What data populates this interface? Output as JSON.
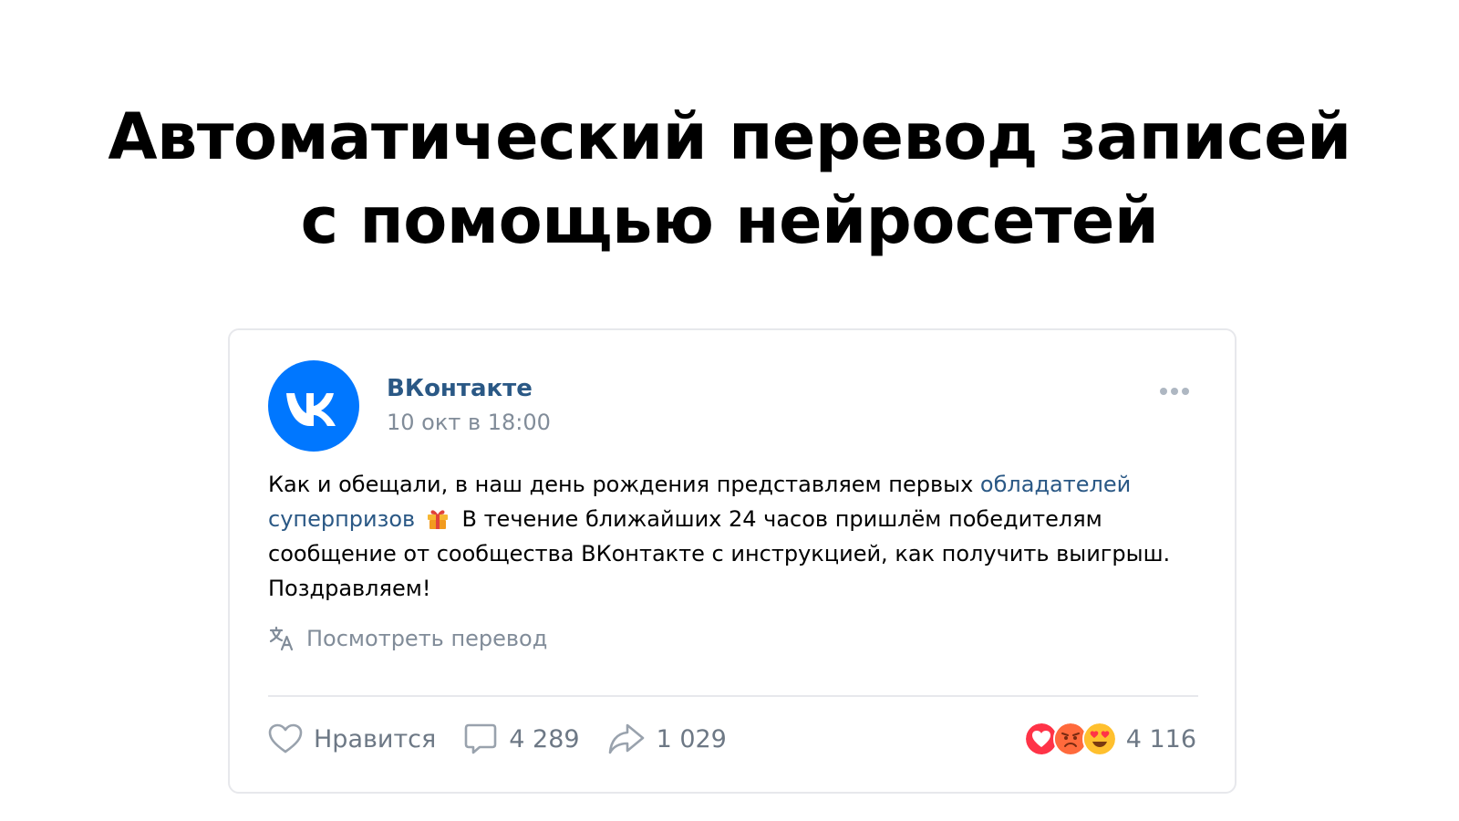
{
  "headline": {
    "line1": "Автоматический перевод записей",
    "line2": "с помощью нейросетей"
  },
  "post": {
    "author": "ВКонтакте",
    "avatar_icon": "vk-logo-icon",
    "date": "10 окт в 18:00",
    "more_icon": "more-dots-icon",
    "text_part1": "Как и обещали, в наш день рождения представляем первых ",
    "text_link": "обладателей суперпризов",
    "text_emoji_icon": "gift-icon",
    "text_part2": " В течение ближайших 24 часов пришлём победителям сообщение от сообщества ВКонтакте с инструкцией, как получить выигрыш. Поздравляем!",
    "translate_label": "Посмотреть перевод",
    "translate_icon": "translate-icon"
  },
  "actions": {
    "like_label": "Нравится",
    "like_icon": "heart-icon",
    "comments_count": "4 289",
    "comment_icon": "comment-icon",
    "shares_count": "1 029",
    "share_icon": "share-icon",
    "reactions_count": "4 116",
    "reaction_icons": [
      "heart-reaction-icon",
      "angry-face-icon",
      "heart-eyes-face-icon"
    ]
  },
  "colors": {
    "brand": "#0077ff",
    "link": "#2a5885",
    "secondary_text": "#818c99",
    "divider": "#e7e8ec"
  }
}
